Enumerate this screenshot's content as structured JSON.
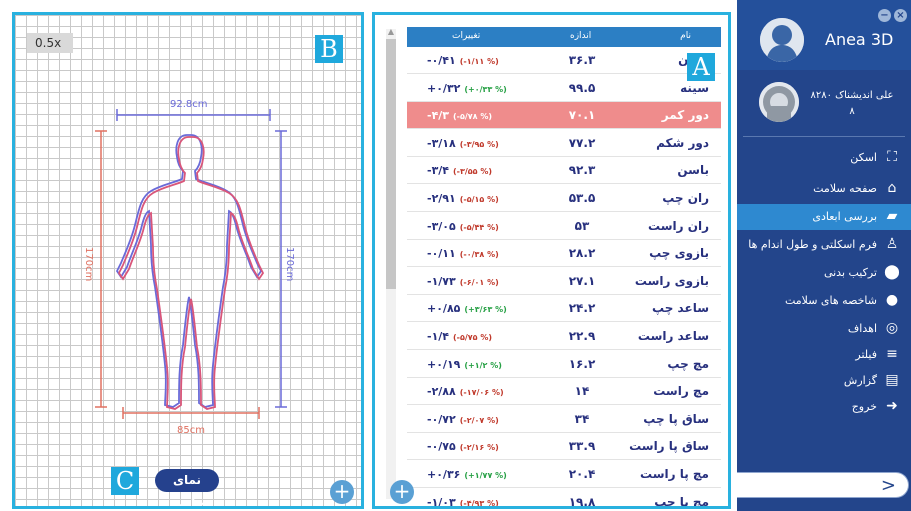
{
  "viewer": {
    "zoom": "0.5x",
    "tag_b": "B",
    "tag_c": "C",
    "width_top": "92.8cm",
    "width_bottom": "85cm",
    "height_left": "170cm",
    "height_right": "170cm",
    "side_view_label": "نمای جانبی",
    "add_symbol": "+"
  },
  "table": {
    "tag_a": "A",
    "headers": {
      "name": "نام",
      "size": "اندازه",
      "change": "تغییرات"
    },
    "add_symbol": "+",
    "rows": [
      {
        "name": "گردن",
        "size": "۳۶.۳",
        "change": "-۰/۴۱",
        "pct": "(-۱/۱۱ %)",
        "sign": "neg"
      },
      {
        "name": "سینه",
        "size": "۹۹.۵",
        "change": "+۰/۳۲",
        "pct": "(+۰/۳۳ %)",
        "sign": "pos"
      },
      {
        "name": "دور کمر",
        "size": "۷۰.۱",
        "change": "-۴/۳",
        "pct": "(-۵/۷۸ %)",
        "sign": "neg",
        "highlight": true
      },
      {
        "name": "دور شکم",
        "size": "۷۷.۲",
        "change": "-۳/۱۸",
        "pct": "(-۳/۹۵ %)",
        "sign": "neg"
      },
      {
        "name": "باسن",
        "size": "۹۲.۳",
        "change": "-۳/۴",
        "pct": "(-۳/۵۵ %)",
        "sign": "neg"
      },
      {
        "name": "ران چپ",
        "size": "۵۳.۵",
        "change": "-۲/۹۱",
        "pct": "(-۵/۱۵ %)",
        "sign": "neg"
      },
      {
        "name": "ران راست",
        "size": "۵۳",
        "change": "-۳/۰۵",
        "pct": "(-۵/۴۴ %)",
        "sign": "neg"
      },
      {
        "name": "بازوی چپ",
        "size": "۲۸.۲",
        "change": "-۰/۱۱",
        "pct": "(-۰/۳۸ %)",
        "sign": "neg"
      },
      {
        "name": "بازوی راست",
        "size": "۲۷.۱",
        "change": "-۱/۷۳",
        "pct": "(-۶/۰۱ %)",
        "sign": "neg"
      },
      {
        "name": "ساعد چپ",
        "size": "۲۴.۲",
        "change": "+۰/۸۵",
        "pct": "(+۳/۶۳ %)",
        "sign": "pos"
      },
      {
        "name": "ساعد راست",
        "size": "۲۲.۹",
        "change": "-۱/۴",
        "pct": "(-۵/۷۵ %)",
        "sign": "neg"
      },
      {
        "name": "مچ چپ",
        "size": "۱۶.۲",
        "change": "+۰/۱۹",
        "pct": "(+۱/۲ %)",
        "sign": "pos"
      },
      {
        "name": "مچ راست",
        "size": "۱۴",
        "change": "-۲/۸۸",
        "pct": "(-۱۷/۰۶ %)",
        "sign": "neg"
      },
      {
        "name": "ساق پا چپ",
        "size": "۳۴",
        "change": "-۰/۷۲",
        "pct": "(-۲/۰۷ %)",
        "sign": "neg"
      },
      {
        "name": "ساق پا راست",
        "size": "۳۳.۹",
        "change": "-۰/۷۵",
        "pct": "(-۲/۱۶ %)",
        "sign": "neg"
      },
      {
        "name": "مچ پا راست",
        "size": "۲۰.۴",
        "change": "+۰/۳۶",
        "pct": "(+۱/۷۷ %)",
        "sign": "pos"
      },
      {
        "name": "مچ پا چپ",
        "size": "۱۹.۸",
        "change": "-۱/۰۳",
        "pct": "(-۴/۹۳ %)",
        "sign": "neg"
      }
    ]
  },
  "sidebar": {
    "app_title": "Anea 3D",
    "minimize": "−",
    "close": "×",
    "user_name": "علی اندیشناک ۸۲۸۰",
    "user_id": "۸",
    "menu": [
      {
        "label": "اسکن",
        "icon": "scan-icon"
      },
      {
        "label": "صفحه سلامت",
        "icon": "home-icon"
      },
      {
        "label": "بررسی ابعادی",
        "icon": "truck-icon",
        "active": true
      },
      {
        "label": "فرم اسکلتی و طول اندام ها",
        "icon": "skeleton-icon"
      },
      {
        "label": "ترکیب بدنی",
        "icon": "location-icon"
      },
      {
        "label": "شاخصه های سلامت",
        "icon": "apple-icon"
      },
      {
        "label": "اهداف",
        "icon": "target-icon"
      },
      {
        "label": "فیلتر",
        "icon": "filter-icon"
      },
      {
        "label": "گزارش",
        "icon": "clipboard-icon"
      },
      {
        "label": "خروج",
        "icon": "exit-icon"
      }
    ],
    "next_arrow": ">"
  }
}
